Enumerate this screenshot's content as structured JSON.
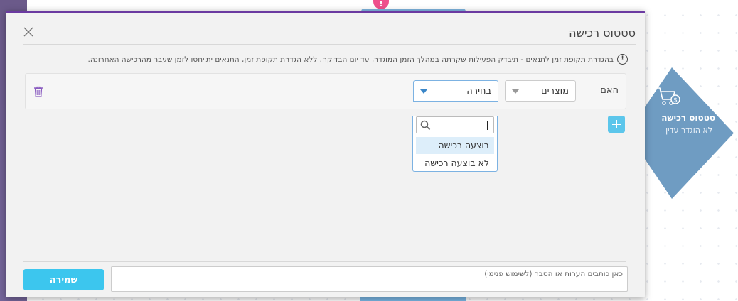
{
  "canvas": {
    "warning_badge": "!",
    "node": {
      "title": "סטטוס רכישה",
      "subtitle": "לא הוגדר עדין",
      "icon": "cart-dollar-icon"
    }
  },
  "modal": {
    "title": "סטטוס רכישה",
    "info_text": "בהגדרת תקופת זמן לתנאים - תיבדק הפעילות שקרתה במהלך הזמן המוגדר, עד יום הבדיקה. ללא הגדרת תקופת זמן, התנאים יתייחסו לזמן שעבר מהרכישה האחרונה.",
    "condition": {
      "label": "האם",
      "field_select": {
        "value": "מוצרים"
      },
      "value_select": {
        "value": "בחירה"
      },
      "dropdown": {
        "search_value": "",
        "options": [
          "בוצעה רכישה",
          "לא בוצעה רכישה"
        ],
        "highlighted_index": 0
      }
    },
    "notes_placeholder": "כאן כותבים הערות או הסבר (לשימוש פנימי)",
    "save_label": "שמירה"
  },
  "colors": {
    "accent_purple": "#6b3aa1",
    "save_button": "#3cc6ee",
    "node": "#6f9cc2",
    "warning": "#ef4f8c"
  }
}
